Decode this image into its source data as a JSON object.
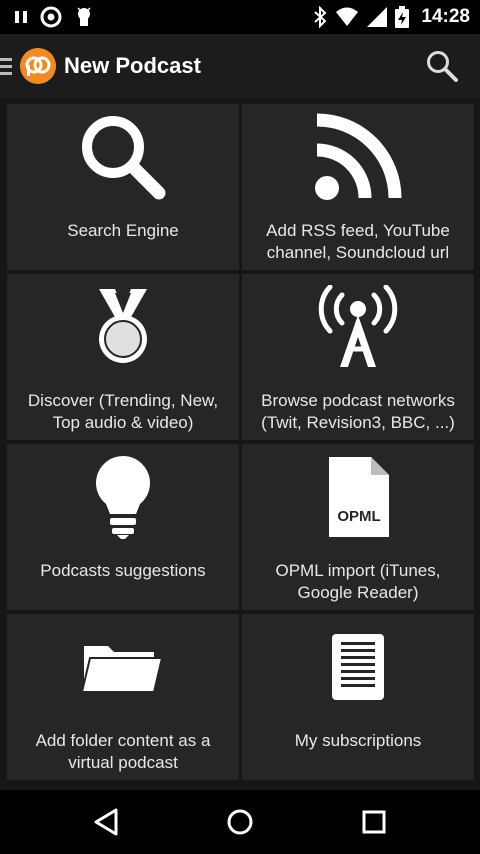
{
  "status_bar": {
    "time": "14:28",
    "icons": [
      "pause-icon",
      "app-notification-icon",
      "android-debug-icon",
      "bluetooth-icon",
      "wifi-icon",
      "signal-icon",
      "battery-charging-icon"
    ]
  },
  "app_bar": {
    "title": "New Podcast",
    "menu_icon": "hamburger-menu-icon",
    "logo": "podcast-addict-logo",
    "action_icon": "search-icon"
  },
  "tiles": [
    {
      "label": "Search Engine",
      "icon": "magnifier-icon"
    },
    {
      "label": "Add RSS feed, YouTube\nchannel, Soundcloud url",
      "icon": "rss-icon"
    },
    {
      "label": "Discover (Trending, New,\nTop audio & video)",
      "icon": "medal-icon"
    },
    {
      "label": "Browse podcast networks\n(Twit, Revision3, BBC, ...)",
      "icon": "antenna-tower-icon"
    },
    {
      "label": "Podcasts suggestions",
      "icon": "lightbulb-icon"
    },
    {
      "label": "OPML import (iTunes,\nGoogle Reader)",
      "icon": "opml-file-icon",
      "icon_text": "OPML"
    },
    {
      "label": "Add folder content as a\nvirtual podcast",
      "icon": "folder-icon"
    },
    {
      "label": "My subscriptions",
      "icon": "list-document-icon"
    }
  ],
  "nav_bar": {
    "back": "back-icon",
    "home": "home-icon",
    "recents": "recents-icon"
  },
  "colors": {
    "accent": "#f28a1e",
    "tile_bg": "#262626",
    "app_bar_bg": "#1c1c1c"
  }
}
